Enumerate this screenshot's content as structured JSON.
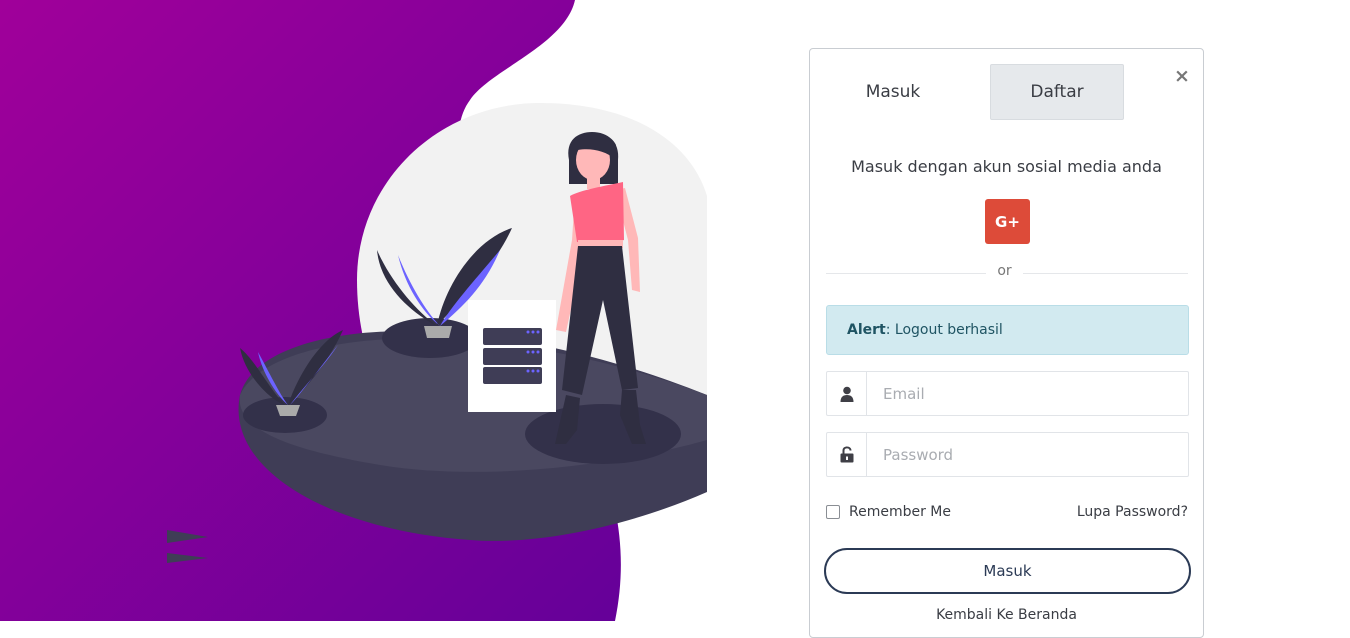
{
  "tabs": {
    "login": "Masuk",
    "register": "Daftar"
  },
  "close_glyph": "×",
  "social": {
    "text": "Masuk dengan akun sosial media anda",
    "google_label": "G+"
  },
  "divider": {
    "text": "or"
  },
  "alert": {
    "label": "Alert",
    "message": ": Logout berhasil"
  },
  "form": {
    "email": {
      "placeholder": "Email",
      "icon": "user-icon"
    },
    "password": {
      "placeholder": "Password",
      "icon": "unlock-icon"
    },
    "remember_label": "Remember Me",
    "forgot_label": "Lupa Password?",
    "submit_label": "Masuk",
    "back_label": "Kembali Ke Beranda"
  },
  "colors": {
    "gradient_start": "#a0009a",
    "gradient_end": "#650099",
    "google": "#dd4b39",
    "alert_bg": "#d2eaf0",
    "button_border": "#2b3a55"
  }
}
